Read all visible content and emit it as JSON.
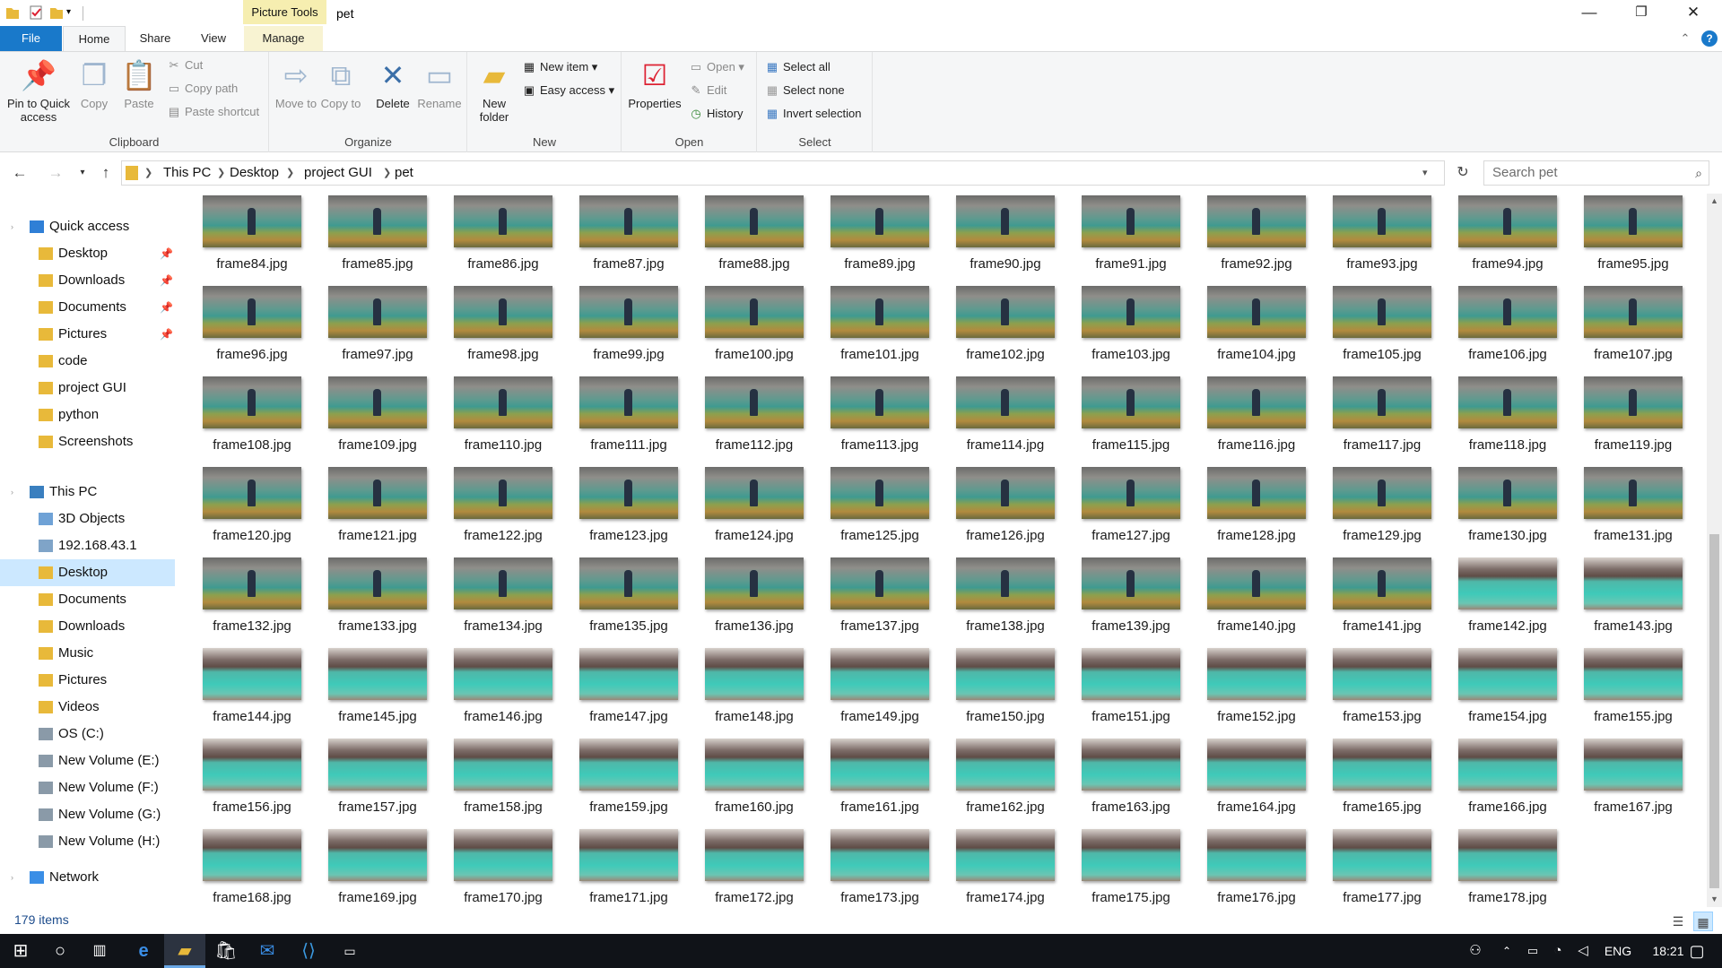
{
  "window": {
    "context_tab": "Picture Tools",
    "title": "pet",
    "minimize": "—",
    "restore": "❐",
    "close": "✕",
    "collapse": "⌃",
    "help": "?"
  },
  "ribbon_tabs": [
    "File",
    "Home",
    "Share",
    "View",
    "Manage"
  ],
  "ribbon": {
    "clipboard": {
      "label": "Clipboard",
      "pin": "Pin to Quick access",
      "copy": "Copy",
      "paste": "Paste",
      "cut": "Cut",
      "copy_path": "Copy path",
      "paste_shortcut": "Paste shortcut"
    },
    "organize": {
      "label": "Organize",
      "move_to": "Move to",
      "copy_to": "Copy to",
      "delete": "Delete",
      "rename": "Rename"
    },
    "new": {
      "label": "New",
      "new_folder": "New folder",
      "new_item": "New item",
      "easy_access": "Easy access"
    },
    "open": {
      "label": "Open",
      "properties": "Properties",
      "open": "Open",
      "edit": "Edit",
      "history": "History"
    },
    "select": {
      "label": "Select",
      "select_all": "Select all",
      "select_none": "Select none",
      "invert": "Invert selection"
    }
  },
  "address": {
    "segments": [
      "This PC",
      "Desktop",
      "project GUI",
      "pet"
    ],
    "search_placeholder": "Search pet"
  },
  "nav": {
    "quick_access": "Quick access",
    "quick_items": [
      "Desktop",
      "Downloads",
      "Documents",
      "Pictures",
      "code",
      "project GUI",
      "python",
      "Screenshots"
    ],
    "this_pc": "This PC",
    "pc_items": [
      "3D Objects",
      "192.168.43.1",
      "Desktop",
      "Documents",
      "Downloads",
      "Music",
      "Pictures",
      "Videos",
      "OS (C:)",
      "New Volume (E:)",
      "New Volume (F:)",
      "New Volume (G:)",
      "New Volume (H:)"
    ],
    "network": "Network",
    "selected": "Desktop"
  },
  "files": {
    "first": 84,
    "last": 178,
    "per_row": 12,
    "prefix": "frame",
    "ext": ".jpg",
    "scene_change_at": 142
  },
  "status": {
    "count": "179 items"
  },
  "taskbar": {
    "lang": "ENG",
    "time": "18:21"
  },
  "colors": {
    "accent": "#1979ca",
    "selection": "#cce8ff",
    "context_tab": "#f6eeb0",
    "taskbar": "#101318"
  }
}
